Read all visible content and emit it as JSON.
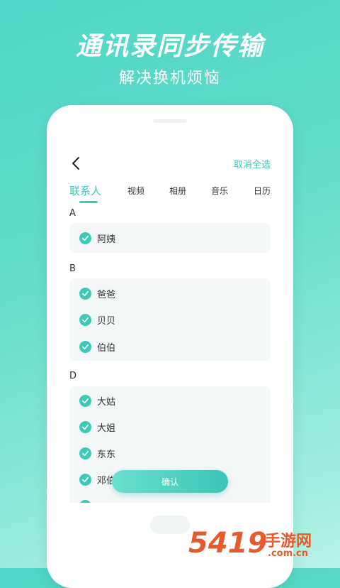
{
  "promo": {
    "headline": "通讯录同步传输",
    "subheadline": "解决换机烦恼"
  },
  "app": {
    "back_icon": "chevron-left-icon",
    "deselect_all": "取消全选",
    "tabs": [
      {
        "label": "联系人",
        "active": true
      },
      {
        "label": "视频",
        "active": false
      },
      {
        "label": "相册",
        "active": false
      },
      {
        "label": "音乐",
        "active": false
      },
      {
        "label": "日历",
        "active": false
      }
    ],
    "sections": [
      {
        "letter": "A",
        "contacts": [
          "阿姨"
        ]
      },
      {
        "letter": "B",
        "contacts": [
          "爸爸",
          "贝贝",
          "伯伯"
        ]
      },
      {
        "letter": "D",
        "contacts": [
          "大姑",
          "大姐",
          "东东",
          "邓伯"
        ]
      }
    ],
    "confirm_label": "确认",
    "accent_color": "#3cc9bb"
  },
  "watermark": {
    "number": "5419",
    "text": "手游网",
    "domain": ".com.cn"
  }
}
